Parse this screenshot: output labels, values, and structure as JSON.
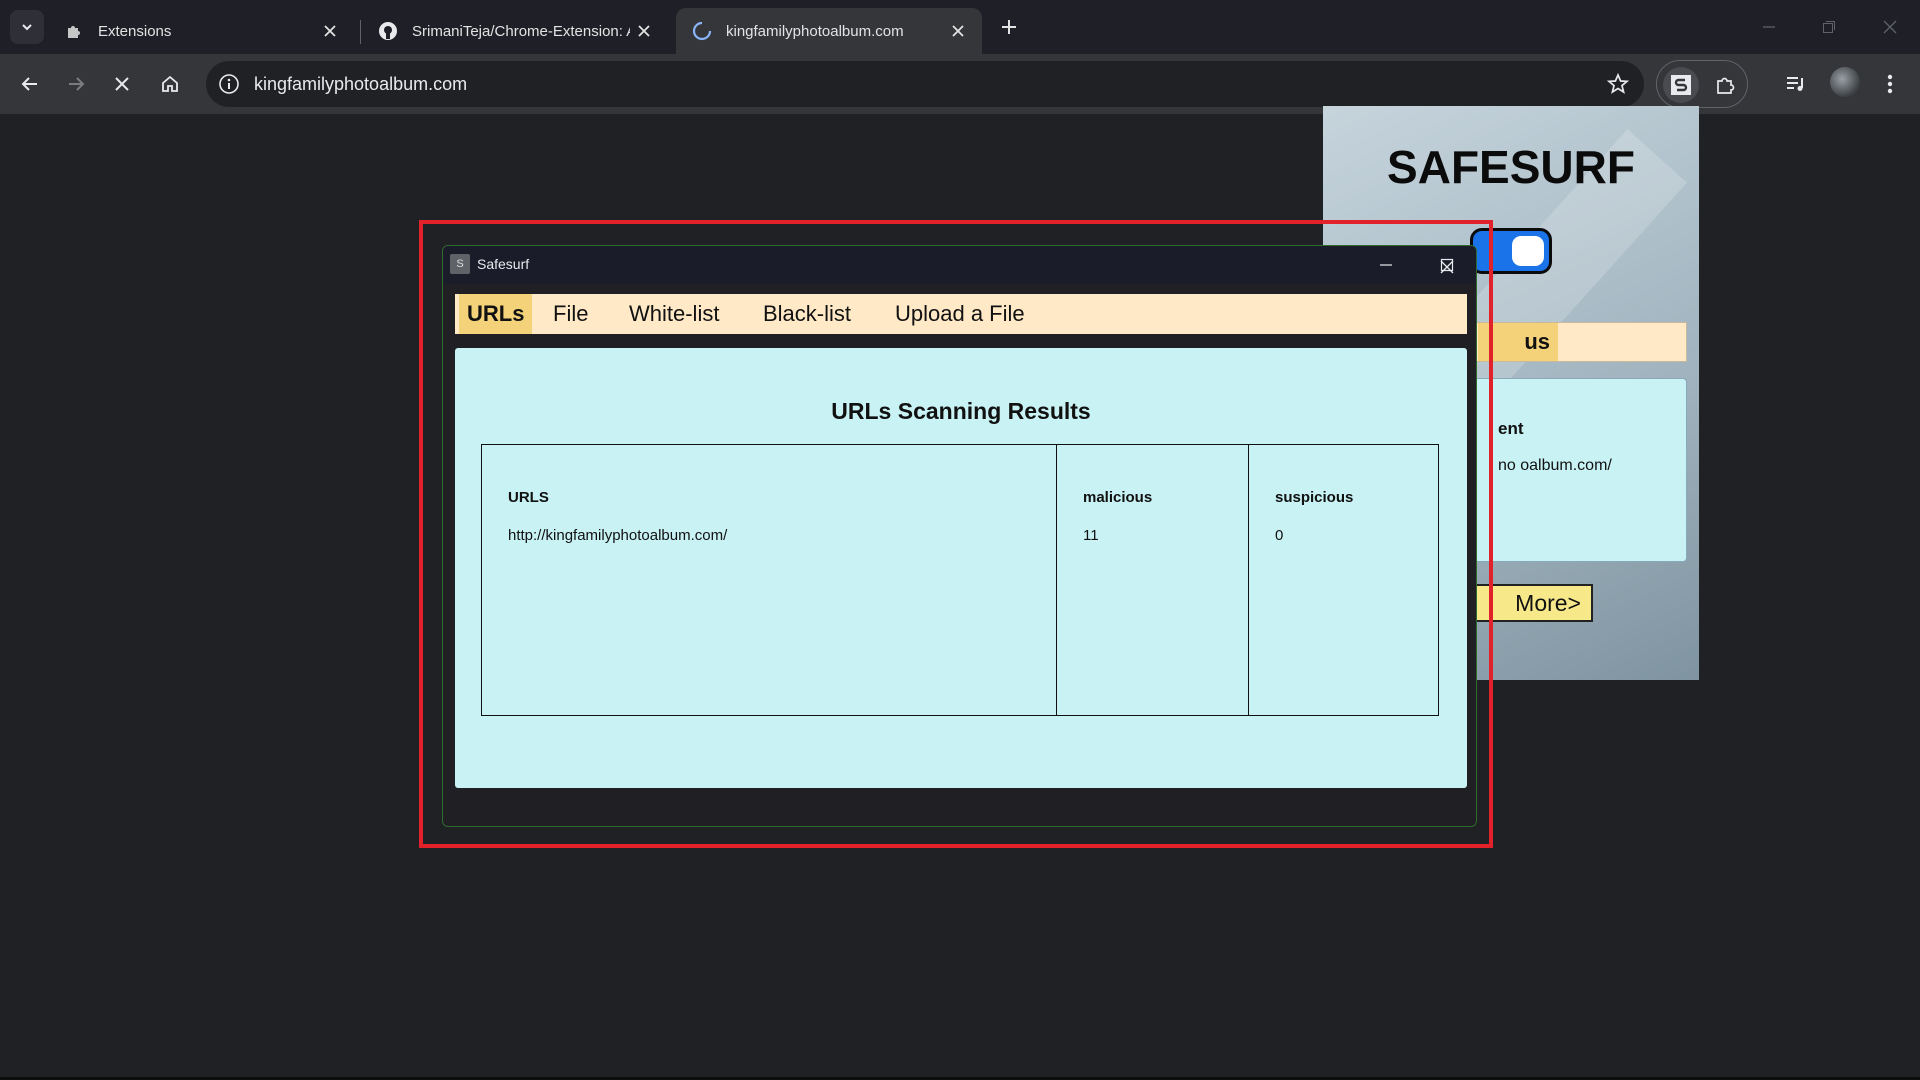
{
  "browser": {
    "tabs": [
      {
        "title": "Extensions",
        "icon": "puzzle-icon",
        "active": false
      },
      {
        "title": "SrimaniTeja/Chrome-Extension: An",
        "icon": "github-icon",
        "active": false
      },
      {
        "title": "kingfamilyphotoalbum.com",
        "icon": "loading-spinner-icon",
        "active": true
      }
    ],
    "address": "kingfamilyphotoalbum.com"
  },
  "popup": {
    "title": "SAFESURF",
    "toggle_on": true,
    "visible_tab": "us",
    "recent_label": "ent",
    "recent_url": "no oalbum.com/",
    "more_button": "More>"
  },
  "window": {
    "title": "Safesurf",
    "app_icon_letter": "S",
    "menu": [
      "URLs",
      "File",
      "White-list",
      "Black-list",
      "Upload a File"
    ],
    "active_menu": "URLs",
    "heading": "URLs Scanning Results",
    "table": {
      "headers": [
        "URLS",
        "malicious",
        "suspicious"
      ],
      "rows": [
        [
          "http://kingfamilyphotoalbum.com/",
          "11",
          "0"
        ]
      ]
    }
  },
  "colors": {
    "menubar": "#ffe9c7",
    "menu_active": "#f4d27a",
    "content": "#c8f2f4",
    "highlight": "#e1222a",
    "toggle": "#1a73e8"
  }
}
